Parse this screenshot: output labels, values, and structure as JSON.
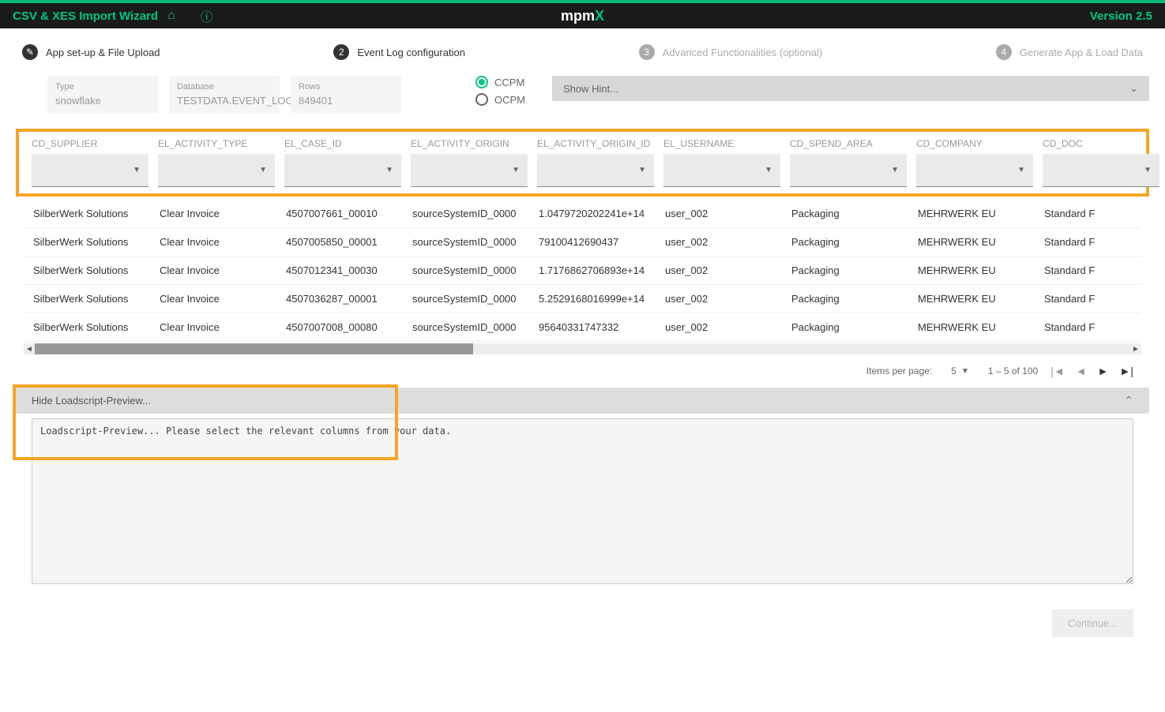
{
  "topbar": {
    "title": "CSV & XES Import Wizard",
    "logo_left": "mpm",
    "logo_right": "X",
    "version": "Version 2.5"
  },
  "stepper": {
    "s1": "App set-up & File Upload",
    "s2": "Event Log configuration",
    "s3": "Advanced Functionalities (optional)",
    "s4": "Generate App & Load Data"
  },
  "meta": {
    "type_label": "Type",
    "type_value": "snowflake",
    "db_label": "Database",
    "db_value": "TESTDATA.EVENT_LOGS.",
    "rows_label": "Rows",
    "rows_value": "849401"
  },
  "radios": {
    "ccpm": "CCPM",
    "ocpm": "OCPM"
  },
  "hint": "Show Hint...",
  "columns": [
    "CD_SUPPLIER",
    "EL_ACTIVITY_TYPE",
    "EL_CASE_ID",
    "EL_ACTIVITY_ORIGIN",
    "EL_ACTIVITY_ORIGIN_ID",
    "EL_USERNAME",
    "CD_SPEND_AREA",
    "CD_COMPANY",
    "CD_DOC"
  ],
  "rows": [
    [
      "SilberWerk Solutions",
      "Clear Invoice",
      "4507007661_00010",
      "sourceSystemID_0000",
      "1.0479720202241e+14",
      "user_002",
      "Packaging",
      "MEHRWERK EU",
      "Standard F"
    ],
    [
      "SilberWerk Solutions",
      "Clear Invoice",
      "4507005850_00001",
      "sourceSystemID_0000",
      "79100412690437",
      "user_002",
      "Packaging",
      "MEHRWERK EU",
      "Standard F"
    ],
    [
      "SilberWerk Solutions",
      "Clear Invoice",
      "4507012341_00030",
      "sourceSystemID_0000",
      "1.7176862706893e+14",
      "user_002",
      "Packaging",
      "MEHRWERK EU",
      "Standard F"
    ],
    [
      "SilberWerk Solutions",
      "Clear Invoice",
      "4507036287_00001",
      "sourceSystemID_0000",
      "5.2529168016999e+14",
      "user_002",
      "Packaging",
      "MEHRWERK EU",
      "Standard F"
    ],
    [
      "SilberWerk Solutions",
      "Clear Invoice",
      "4507007008_00080",
      "sourceSystemID_0000",
      "95640331747332",
      "user_002",
      "Packaging",
      "MEHRWERK EU",
      "Standard F"
    ]
  ],
  "paginator": {
    "items_label": "Items per page:",
    "items_value": "5",
    "range": "1 – 5 of 100"
  },
  "loadscript": {
    "header": "Hide Loadscript-Preview...",
    "body": "Loadscript-Preview... Please select the relevant columns from your data."
  },
  "footer": {
    "continue": "Continue..."
  }
}
